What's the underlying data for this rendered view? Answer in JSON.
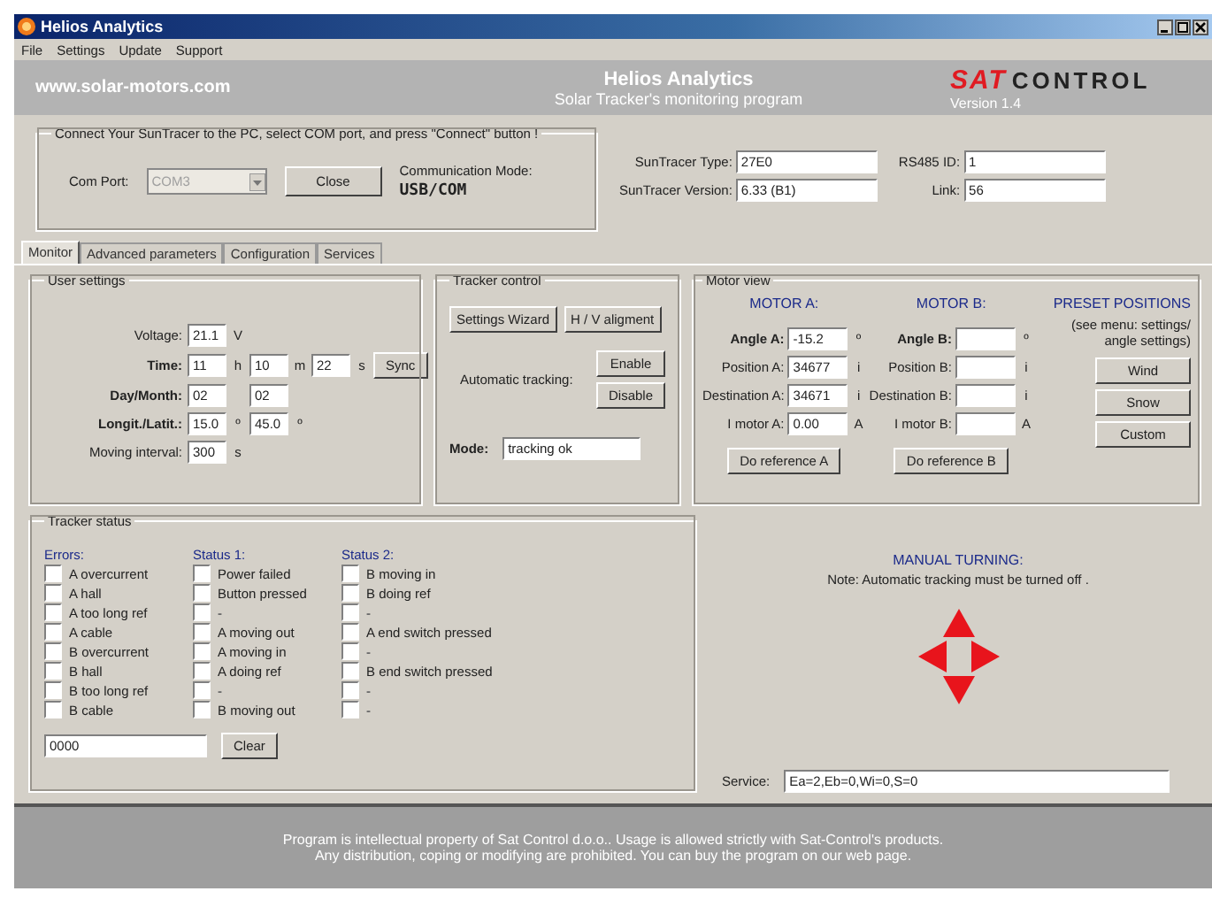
{
  "window": {
    "title": "Helios Analytics"
  },
  "menu": [
    "File",
    "Settings",
    "Update",
    "Support"
  ],
  "header": {
    "website": "www.solar-motors.com",
    "title": "Helios Analytics",
    "subtitle": "Solar Tracker's monitoring program",
    "logo_part_1": "SAT",
    "logo_part_2": "CONTROL",
    "version": "Version 1.4"
  },
  "connect": {
    "legend": "Connect Your SunTracer to the PC, select COM port, and press \"Connect\" button !",
    "com_port_label": "Com Port:",
    "com_port_value": "COM3",
    "com_port_disabled": true,
    "close_button": "Close",
    "mode_label": "Communication Mode:",
    "mode_value": "USB/COM"
  },
  "device_info": [
    {
      "label": "SunTracer Type:",
      "value": "27E0"
    },
    {
      "label": "SunTracer Version:",
      "value": "6.33 (B1)"
    }
  ],
  "link_info": [
    {
      "label": "RS485 ID:",
      "value": "1"
    },
    {
      "label": "Link:",
      "value": "56"
    }
  ],
  "tabs": [
    {
      "label": "Monitor",
      "selected": true
    },
    {
      "label": "Advanced parameters",
      "selected": false
    },
    {
      "label": "Configuration",
      "selected": false
    },
    {
      "label": "Services",
      "selected": false
    }
  ],
  "user_settings": {
    "legend": "User settings",
    "rows": [
      {
        "label": "Voltage:",
        "bold": false,
        "fields": [
          {
            "value": "21.1",
            "unit": "V"
          }
        ]
      },
      {
        "label": "Time:",
        "bold": true,
        "fields": [
          {
            "value": "11",
            "unit": "h"
          },
          {
            "value": "10",
            "unit": "m"
          },
          {
            "value": "22",
            "unit": "s"
          }
        ],
        "button": "Sync"
      },
      {
        "label": "Day/Month:",
        "bold": true,
        "fields": [
          {
            "value": "02"
          },
          {
            "value": "02"
          }
        ]
      },
      {
        "label": "Longit./Latit.:",
        "bold": true,
        "fields": [
          {
            "value": "15.0",
            "unit": "º"
          },
          {
            "value": "45.0",
            "unit": "º"
          }
        ]
      },
      {
        "label": "Moving interval:",
        "bold": false,
        "fields": [
          {
            "value": "300",
            "unit": "s"
          }
        ]
      }
    ]
  },
  "tracker_control": {
    "legend": "Tracker control",
    "buttons": [
      "Settings Wizard",
      "H / V aligment"
    ],
    "auto_label": "Automatic tracking:",
    "enable_button": "Enable",
    "disable_button": "Disable",
    "mode_label": "Mode:",
    "mode_value": "tracking ok"
  },
  "motor_view": {
    "legend": "Motor view",
    "motor_a_title": "MOTOR A:",
    "motor_b_title": "MOTOR B:",
    "preset_title": "PRESET POSITIONS",
    "preset_note": "(see menu: settings/ angle settings)",
    "rows": [
      {
        "label_a": "Angle A:",
        "value_a": "-15.2",
        "unit_a": "º",
        "label_b": "Angle B:",
        "unit_b": "º",
        "bold": true
      },
      {
        "label_a": "Position A:",
        "value_a": "34677",
        "unit_a": "i",
        "label_b": "Position B:",
        "unit_b": "i",
        "bold": false
      },
      {
        "label_a": "Destination A:",
        "value_a": "34671",
        "unit_a": "i",
        "label_b": "Destination B:",
        "unit_b": "i",
        "bold": false
      },
      {
        "label_a": "I motor A:",
        "value_a": "0.00",
        "unit_a": "A",
        "label_b": "I motor B:",
        "unit_b": "A",
        "bold": false
      }
    ],
    "reference_buttons": [
      "Do reference A",
      "Do reference B"
    ],
    "preset_buttons": [
      "Wind",
      "Snow",
      "Custom"
    ]
  },
  "tracker_status": {
    "legend": "Tracker status",
    "columns": [
      {
        "title": "Errors:",
        "items": [
          {
            "label": "A overcurrent",
            "checked": false,
            "disabled": false
          },
          {
            "label": "A hall",
            "checked": false,
            "disabled": false
          },
          {
            "label": "A too long ref",
            "checked": false,
            "disabled": false
          },
          {
            "label": "A cable",
            "checked": false,
            "disabled": false
          },
          {
            "label": "B overcurrent",
            "checked": false,
            "disabled": false
          },
          {
            "label": "B hall",
            "checked": false,
            "disabled": false
          },
          {
            "label": "B too long ref",
            "checked": false,
            "disabled": false
          },
          {
            "label": "B cable",
            "checked": false,
            "disabled": false
          }
        ]
      },
      {
        "title": "Status 1:",
        "items": [
          {
            "label": "Power failed",
            "checked": false,
            "disabled": false
          },
          {
            "label": "Button pressed",
            "checked": false,
            "disabled": false
          },
          {
            "label": "-",
            "checked": false,
            "disabled": true
          },
          {
            "label": "A moving out",
            "checked": false,
            "disabled": false
          },
          {
            "label": "A moving in",
            "checked": false,
            "disabled": false
          },
          {
            "label": "A doing ref",
            "checked": false,
            "disabled": false
          },
          {
            "label": "-",
            "checked": false,
            "disabled": true
          },
          {
            "label": "B moving out",
            "checked": false,
            "disabled": false
          }
        ]
      },
      {
        "title": "Status 2:",
        "items": [
          {
            "label": "B moving in",
            "checked": false,
            "disabled": false
          },
          {
            "label": "B doing ref",
            "checked": false,
            "disabled": false
          },
          {
            "label": "-",
            "checked": false,
            "disabled": true
          },
          {
            "label": "A end switch pressed",
            "checked": false,
            "disabled": false
          },
          {
            "label": "-",
            "checked": false,
            "disabled": true
          },
          {
            "label": "B end switch pressed",
            "checked": false,
            "disabled": false
          },
          {
            "label": "-",
            "checked": false,
            "disabled": true
          },
          {
            "label": "-",
            "checked": false,
            "disabled": true
          }
        ]
      }
    ],
    "code_value": "0000",
    "clear_button": "Clear"
  },
  "manual_turning": {
    "title": "MANUAL TURNING:",
    "note": "Note: Automatic tracking must be turned off ."
  },
  "service": {
    "label": "Service:",
    "value": "Ea=2,Eb=0,Wi=0,S=0"
  },
  "footer": [
    "Program is intellectual property of Sat Control d.o.o.. Usage is allowed strictly with Sat-Control's products.",
    "Any distribution, coping or modifying are prohibited. You can buy the program on our web page."
  ]
}
